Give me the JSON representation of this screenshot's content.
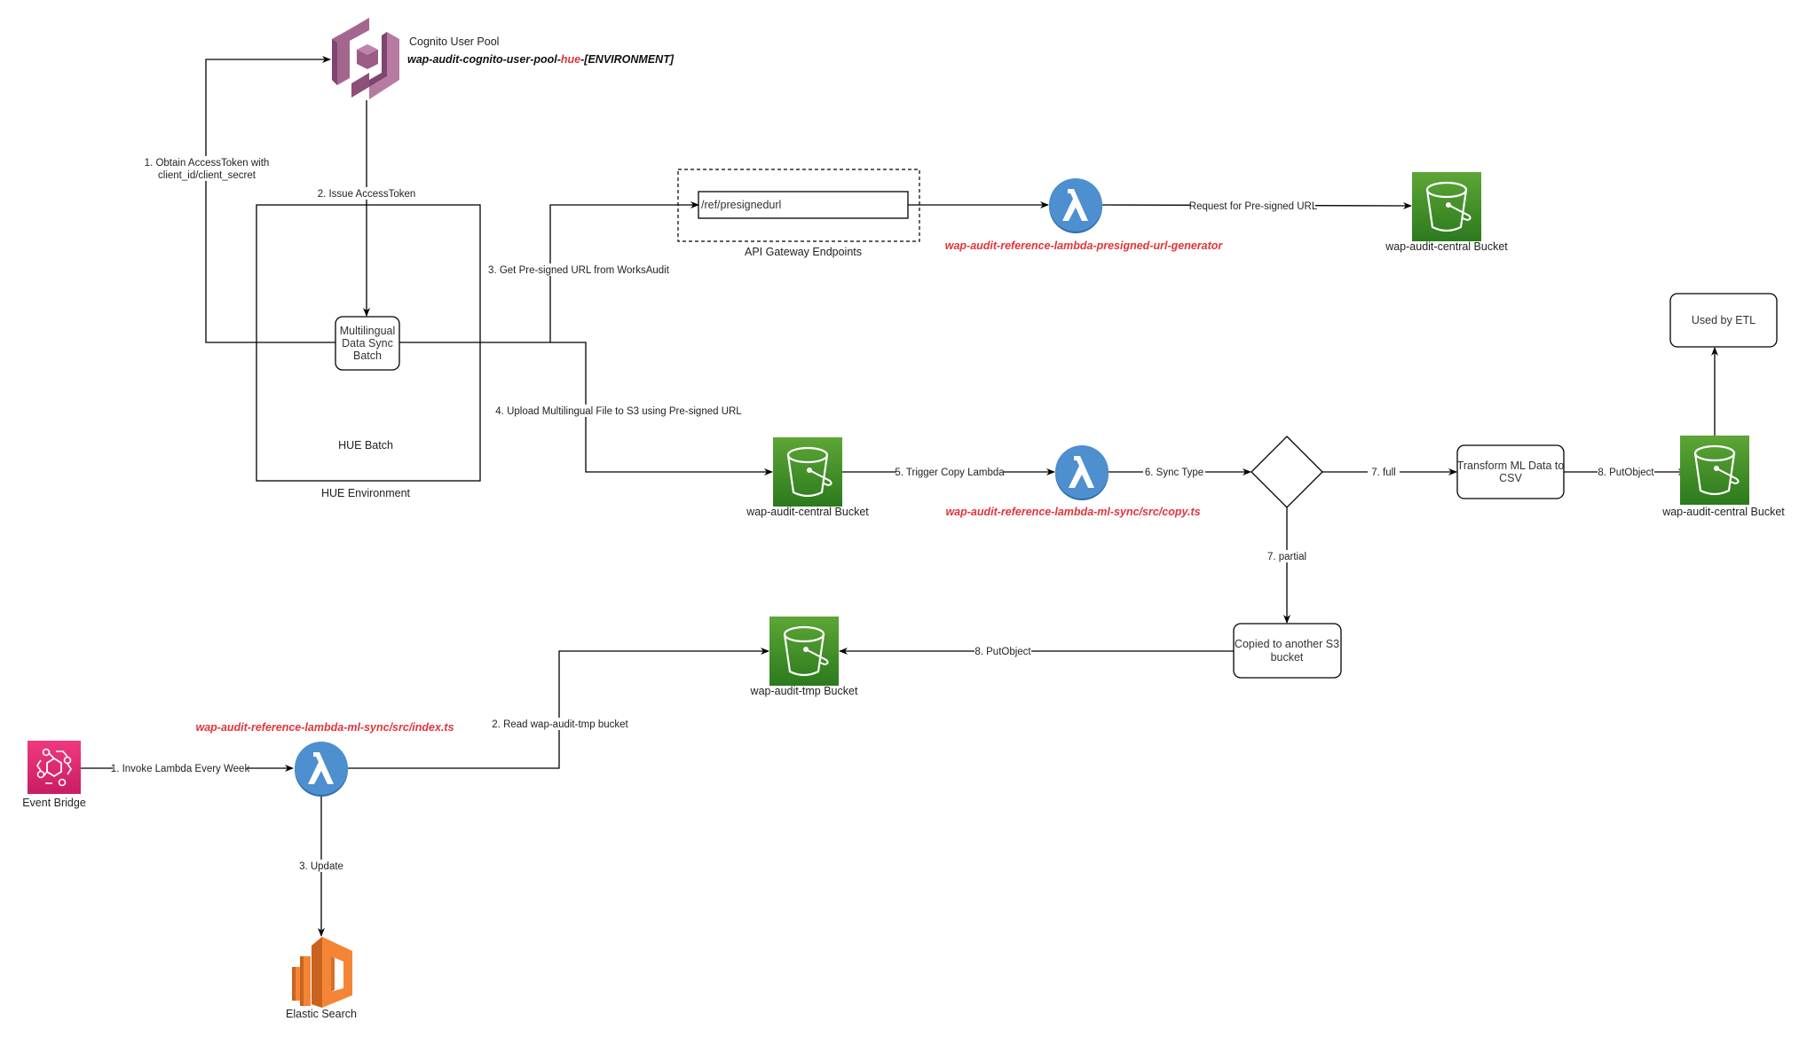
{
  "cognito": {
    "title": "Cognito User Pool",
    "pool_name_prefix": "wap-audit-cognito-user-pool-",
    "pool_name_highlight": "hue",
    "pool_name_suffix": "-[ENVIRONMENT]"
  },
  "hue": {
    "environment_label": "HUE Environment",
    "batch_label": "HUE Batch",
    "sync_batch_lines": [
      "Multilingual",
      "Data Sync",
      "Batch"
    ]
  },
  "api_gateway": {
    "label": "API Gateway Endpoints",
    "endpoint": "/ref/presignedurl"
  },
  "lambdas": {
    "presigned": "wap-audit-reference-lambda-presigned-url-generator",
    "copy": "wap-audit-reference-lambda-ml-sync/src/copy.ts",
    "index": "wap-audit-reference-lambda-ml-sync/src/index.ts"
  },
  "buckets": {
    "central_top": "wap-audit-central Bucket",
    "central_mid": "wap-audit-central Bucket",
    "central_right": "wap-audit-central Bucket",
    "tmp": "wap-audit-tmp Bucket"
  },
  "nodes": {
    "used_by_etl": "Used by ETL",
    "transform_lines": [
      "Transform ML Data to",
      "CSV"
    ],
    "copied_lines": [
      "Copied to another S3",
      "bucket"
    ],
    "event_bridge": "Event Bridge",
    "elastic_search": "Elastic Search"
  },
  "edges": {
    "obtain_token_lines": [
      "1. Obtain AccessToken with",
      "client_id/client_secret"
    ],
    "issue_token": "2. Issue AccessToken",
    "get_presigned": "3. Get Pre-signed URL from WorksAudit",
    "request_presigned": "Request for Pre-signed URL",
    "upload": "4. Upload Multilingual File to S3 using Pre-signed URL",
    "trigger_copy": "5. Trigger Copy Lambda",
    "sync_type": "6. Sync Type",
    "full": "7. full",
    "partial": "7. partial",
    "put_object_right": "8. PutObject",
    "put_object_tmp": "8. PutObject",
    "invoke_weekly": "1. Invoke Lambda Every Week",
    "read_tmp": "2. Read wap-audit-tmp bucket",
    "update": "3. Update"
  },
  "colors": {
    "highlight_red": "#e0353b",
    "s3_green_top": "#5a9e33",
    "s3_green_bottom": "#2e7d1e",
    "lambda_blue": "#4d8fcf",
    "cognito_purple": "#a4668f",
    "eventbridge_pink": "#e7317a",
    "elastic_orange": "#f58536"
  }
}
